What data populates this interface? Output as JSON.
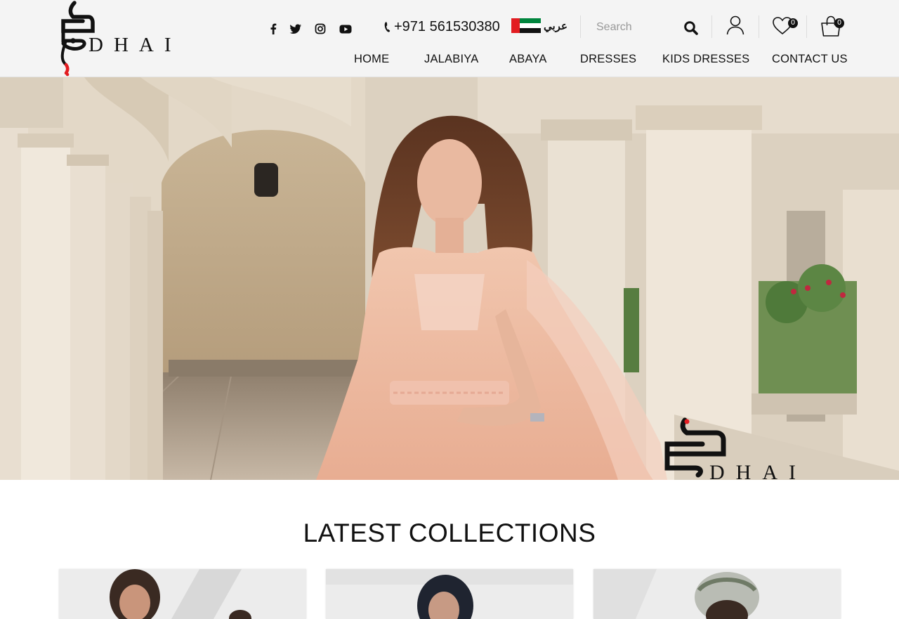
{
  "brand": {
    "logo_text": "DHAI",
    "logo_arabic": "ضحى"
  },
  "header": {
    "social": [
      {
        "name": "facebook",
        "icon": "facebook-icon"
      },
      {
        "name": "twitter",
        "icon": "twitter-icon"
      },
      {
        "name": "instagram",
        "icon": "instagram-icon"
      },
      {
        "name": "youtube",
        "icon": "youtube-icon"
      }
    ],
    "phone": "+971 561530380",
    "language_label": "عربي",
    "search_placeholder": "Search",
    "wishlist_count": "0",
    "cart_count": "0"
  },
  "nav": {
    "items": [
      "HOME",
      "JALABIYA",
      "ABAYA",
      "DRESSES",
      "KIDS DRESSES",
      "CONTACT US"
    ]
  },
  "hero": {
    "watermark_text": "DHAI"
  },
  "collections": {
    "title": "LATEST COLLECTIONS",
    "cards": [
      {
        "name": "collection-card-1"
      },
      {
        "name": "collection-card-2"
      },
      {
        "name": "collection-card-3"
      }
    ]
  },
  "colors": {
    "header_bg": "#f4f4f4",
    "text": "#111111",
    "accent_red": "#e21c21",
    "flag_green": "#00843d"
  }
}
